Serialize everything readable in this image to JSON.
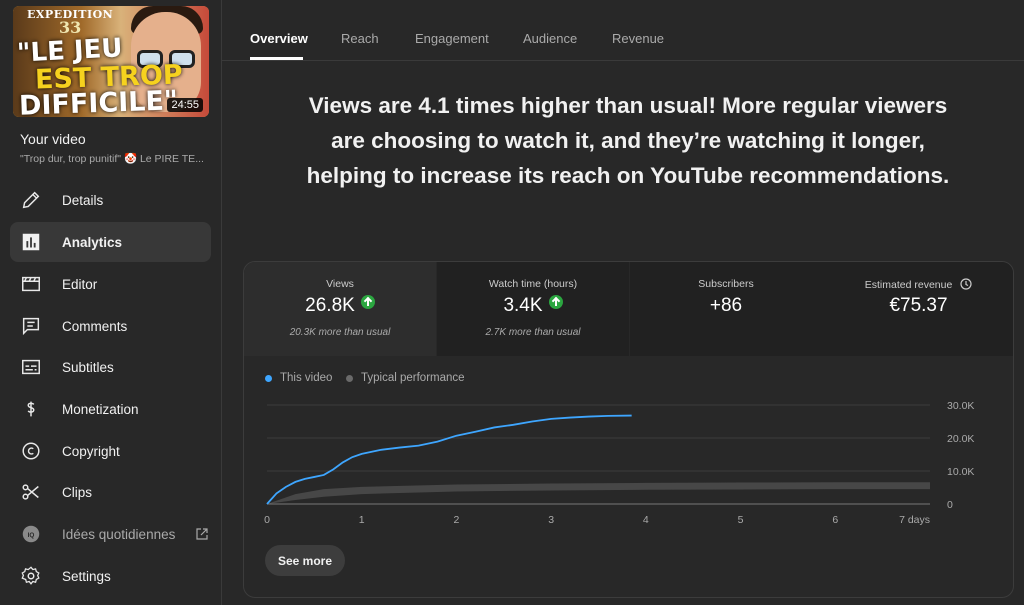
{
  "video": {
    "thumb_line0": "EXPEDITION",
    "thumb_line0b": "33",
    "thumb_line1": "\"LE JEU",
    "thumb_line2": "EST TROP",
    "thumb_line3": "DIFFICILE\"",
    "duration": "24:55",
    "section_label": "Your video",
    "title": "\"Trop dur, trop punitif\" 🤡 Le PIRE TE..."
  },
  "sidebar": {
    "items": [
      {
        "label": "Details",
        "icon": "pencil-icon"
      },
      {
        "label": "Analytics",
        "icon": "bar-chart-icon",
        "active": true
      },
      {
        "label": "Editor",
        "icon": "clapper-icon"
      },
      {
        "label": "Comments",
        "icon": "comment-icon"
      },
      {
        "label": "Subtitles",
        "icon": "subtitles-icon"
      },
      {
        "label": "Monetization",
        "icon": "dollar-icon"
      },
      {
        "label": "Copyright",
        "icon": "copyright-icon"
      },
      {
        "label": "Clips",
        "icon": "scissors-icon"
      },
      {
        "label": "Idées quotidiennes",
        "icon": "ideas-icon"
      },
      {
        "label": "Settings",
        "icon": "gear-icon"
      }
    ]
  },
  "tabs": [
    "Overview",
    "Reach",
    "Engagement",
    "Audience",
    "Revenue"
  ],
  "headline": "Views are 4.1 times higher than usual! More regular viewers are choosing to watch it, and they’re watching it longer, helping to increase its reach on YouTube recommendations.",
  "metrics": [
    {
      "title": "Views",
      "value": "26.8K",
      "sub": "20.3K more than usual"
    },
    {
      "title": "Watch time (hours)",
      "value": "3.4K",
      "sub": "2.7K more than usual"
    },
    {
      "title": "Subscribers",
      "value": "+86",
      "sub": ""
    },
    {
      "title": "Estimated revenue",
      "value": "€75.37",
      "sub": ""
    }
  ],
  "legend": {
    "this_video": "This video",
    "typical": "Typical performance"
  },
  "see_more": "See more",
  "colors": {
    "accent": "#3ea6ff",
    "up": "#2ba640",
    "typical": "#5a5a5a"
  },
  "chart_data": {
    "type": "line",
    "xlabel": "",
    "ylabel": "",
    "xlim": [
      0,
      7
    ],
    "ylim": [
      0,
      30000
    ],
    "x_ticks": [
      "0",
      "1",
      "2",
      "3",
      "4",
      "5",
      "6",
      "7 days"
    ],
    "y_ticks": [
      "30.0K",
      "20.0K",
      "10.0K",
      "0"
    ],
    "grid": true,
    "series": [
      {
        "name": "This video",
        "x": [
          0,
          0.1,
          0.2,
          0.3,
          0.4,
          0.5,
          0.6,
          0.7,
          0.8,
          0.9,
          1.0,
          1.2,
          1.4,
          1.6,
          1.8,
          2.0,
          2.2,
          2.4,
          2.6,
          2.8,
          3.0,
          3.2,
          3.4,
          3.6,
          3.85
        ],
        "y": [
          0,
          3200,
          5200,
          6700,
          7600,
          8200,
          8800,
          10500,
          12600,
          14200,
          15200,
          16400,
          17100,
          17700,
          18900,
          20700,
          21900,
          23200,
          24000,
          25000,
          25800,
          26200,
          26500,
          26700,
          26800
        ]
      },
      {
        "name": "Typical performance",
        "x": [
          0,
          0.3,
          0.6,
          1,
          2,
          3,
          4,
          5,
          6,
          7
        ],
        "low": [
          0,
          1200,
          2200,
          3000,
          3800,
          4100,
          4300,
          4400,
          4500,
          4500
        ],
        "high": [
          0,
          3000,
          4500,
          5200,
          5900,
          6200,
          6400,
          6500,
          6600,
          6600
        ]
      }
    ]
  }
}
